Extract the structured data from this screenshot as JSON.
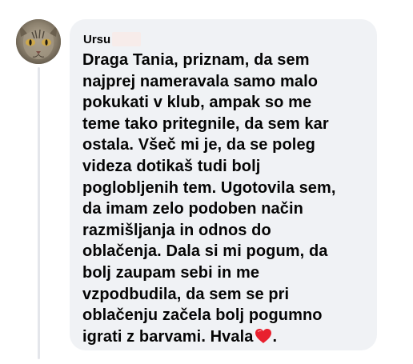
{
  "comment": {
    "author": "Ursu",
    "author_surname_redacted": true,
    "avatar_icon": "cat-avatar",
    "lines": [
      "Draga Tania, priznam, da sem",
      "najprej nameravala samo malo",
      "pokukati v klub, ampak so me",
      "teme tako pritegnile, da sem kar",
      "ostala. Všeč mi je, da se poleg",
      "videza dotikaš tudi bolj",
      "poglobljenih tem. Ugotovila sem,",
      "da imam zelo podoben način",
      "razmišljanja in odnos do",
      "oblačenja. Dala si mi pogum, da",
      "bolj zaupam sebi in me",
      "vzpodbudila, da sem se pri",
      "oblačenju začela bolj pogumno"
    ],
    "last_line_before_emoji": "igrati z barvami. Hvala",
    "last_line_emoji": "heart-icon",
    "last_line_after_emoji": ".",
    "colors": {
      "bubble": "#f0f2f5",
      "text": "#050505",
      "heart": "#e8202e"
    }
  }
}
